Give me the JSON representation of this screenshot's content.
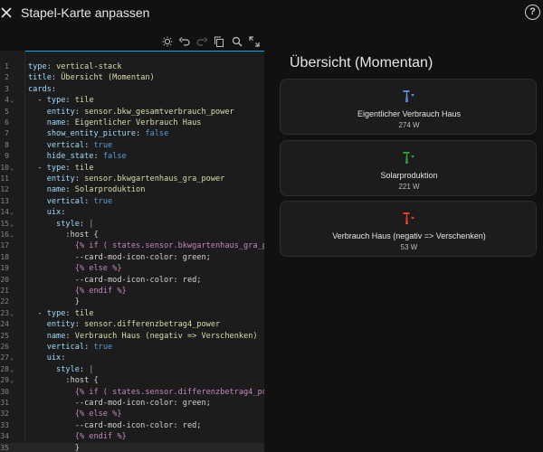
{
  "dialog": {
    "title": "Stapel-Karte anpassen",
    "close_icon": "close-icon",
    "help_icon": "help-circle-icon",
    "help_glyph": "?"
  },
  "toolbar": {
    "icons": [
      "lightbulb-icon",
      "undo-icon",
      "redo-icon",
      "copy-icon",
      "search-icon",
      "fullscreen-icon"
    ]
  },
  "editor": {
    "active_line": 35,
    "lines": [
      {
        "n": "1",
        "fold": "",
        "text": "type: vertical-stack"
      },
      {
        "n": "2",
        "fold": "",
        "text": "title: Übersicht (Momentan)"
      },
      {
        "n": "3",
        "fold": "",
        "text": "cards:"
      },
      {
        "n": "4",
        "fold": "⌄",
        "text": "  - type: tile"
      },
      {
        "n": "5",
        "fold": "",
        "text": "    entity: sensor.bkw_gesamtverbrauch_power"
      },
      {
        "n": "6",
        "fold": "",
        "text": "    name: Eigentlicher Verbrauch Haus"
      },
      {
        "n": "7",
        "fold": "",
        "text": "    show_entity_picture: false"
      },
      {
        "n": "8",
        "fold": "",
        "text": "    vertical: true"
      },
      {
        "n": "9",
        "fold": "",
        "text": "    hide_state: false"
      },
      {
        "n": "10",
        "fold": "⌄",
        "text": "  - type: tile"
      },
      {
        "n": "11",
        "fold": "",
        "text": "    entity: sensor.bkwgartenhaus_gra_power"
      },
      {
        "n": "12",
        "fold": "",
        "text": "    name: Solarproduktion"
      },
      {
        "n": "13",
        "fold": "",
        "text": "    vertical: true"
      },
      {
        "n": "14",
        "fold": "⌄",
        "text": "    uix:"
      },
      {
        "n": "15",
        "fold": "⌄",
        "text": "      style: |"
      },
      {
        "n": "16",
        "fold": "⌄",
        "text": "        :host {"
      },
      {
        "n": "17",
        "fold": "",
        "text": "          {% if ( states.sensor.bkwgartenhaus_gra_p"
      },
      {
        "n": "18",
        "fold": "",
        "text": "          --card-mod-icon-color: green;"
      },
      {
        "n": "19",
        "fold": "",
        "text": "          {% else %}"
      },
      {
        "n": "20",
        "fold": "",
        "text": "          --card-mod-icon-color: red;"
      },
      {
        "n": "21",
        "fold": "",
        "text": "          {% endif %}"
      },
      {
        "n": "22",
        "fold": "",
        "text": "          }"
      },
      {
        "n": "23",
        "fold": "⌄",
        "text": "  - type: tile"
      },
      {
        "n": "24",
        "fold": "",
        "text": "    entity: sensor.differenzbetrag4_power"
      },
      {
        "n": "25",
        "fold": "",
        "text": "    name: Verbrauch Haus (negativ => Verschenken)"
      },
      {
        "n": "26",
        "fold": "",
        "text": "    vertical: true"
      },
      {
        "n": "27",
        "fold": "⌄",
        "text": "    uix:"
      },
      {
        "n": "28",
        "fold": "⌄",
        "text": "      style: |"
      },
      {
        "n": "29",
        "fold": "⌄",
        "text": "        :host {"
      },
      {
        "n": "30",
        "fold": "",
        "text": "          {% if ( states.sensor.differenzbetrag4_po"
      },
      {
        "n": "31",
        "fold": "",
        "text": "          --card-mod-icon-color: green;"
      },
      {
        "n": "32",
        "fold": "",
        "text": "          {% else %}"
      },
      {
        "n": "33",
        "fold": "",
        "text": "          --card-mod-icon-color: red;"
      },
      {
        "n": "34",
        "fold": "",
        "text": "          {% endif %}"
      },
      {
        "n": "35",
        "fold": "",
        "text": "          }"
      }
    ]
  },
  "preview": {
    "title": "Übersicht (Momentan)",
    "tiles": [
      {
        "name": "Eigentlicher Verbrauch Haus",
        "state": "274 W",
        "icon": "transmission-tower-import-icon",
        "icon_color": "#5b8bd8"
      },
      {
        "name": "Solarproduktion",
        "state": "221 W",
        "icon": "transmission-tower-import-icon",
        "icon_color": "#2e9d3a"
      },
      {
        "name": "Verbrauch Haus (negativ => Verschenken)",
        "state": "53 W",
        "icon": "transmission-tower-export-icon",
        "icon_color": "#e53935"
      }
    ]
  }
}
